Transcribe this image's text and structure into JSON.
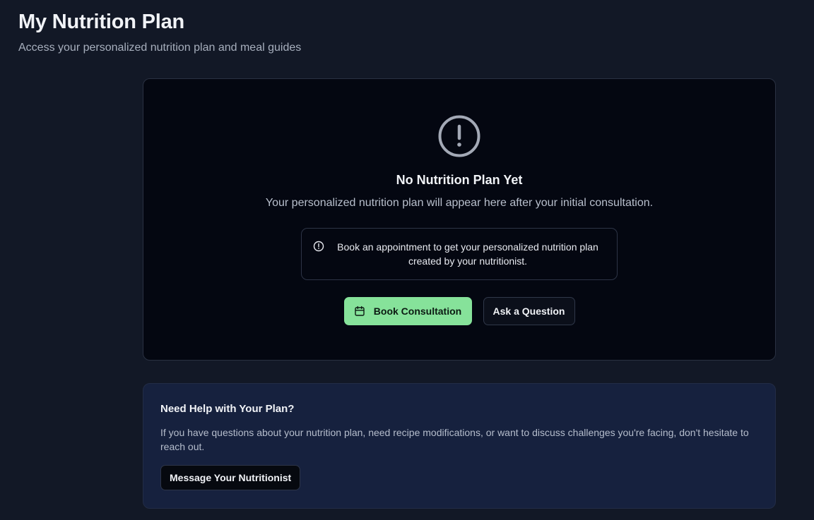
{
  "header": {
    "title": "My Nutrition Plan",
    "subtitle": "Access your personalized nutrition plan and meal guides"
  },
  "empty_state": {
    "icon": "alert-circle-icon",
    "title": "No Nutrition Plan Yet",
    "description": "Your personalized nutrition plan will appear here after your initial consultation.",
    "notice": {
      "icon": "info-circle-icon",
      "text": "Book an appointment to get your personalized nutrition plan created by your nutritionist."
    },
    "actions": {
      "book_label": "Book Consultation",
      "book_icon": "calendar-icon",
      "ask_label": "Ask a Question"
    }
  },
  "help": {
    "title": "Need Help with Your Plan?",
    "text": "If you have questions about your nutrition plan, need recipe modifications, or want to discuss challenges you're facing, don't hesitate to reach out.",
    "button_label": "Message Your Nutritionist"
  },
  "colors": {
    "background": "#121826",
    "card": "#040711",
    "help_card": "#16213e",
    "accent": "#86e29a"
  }
}
